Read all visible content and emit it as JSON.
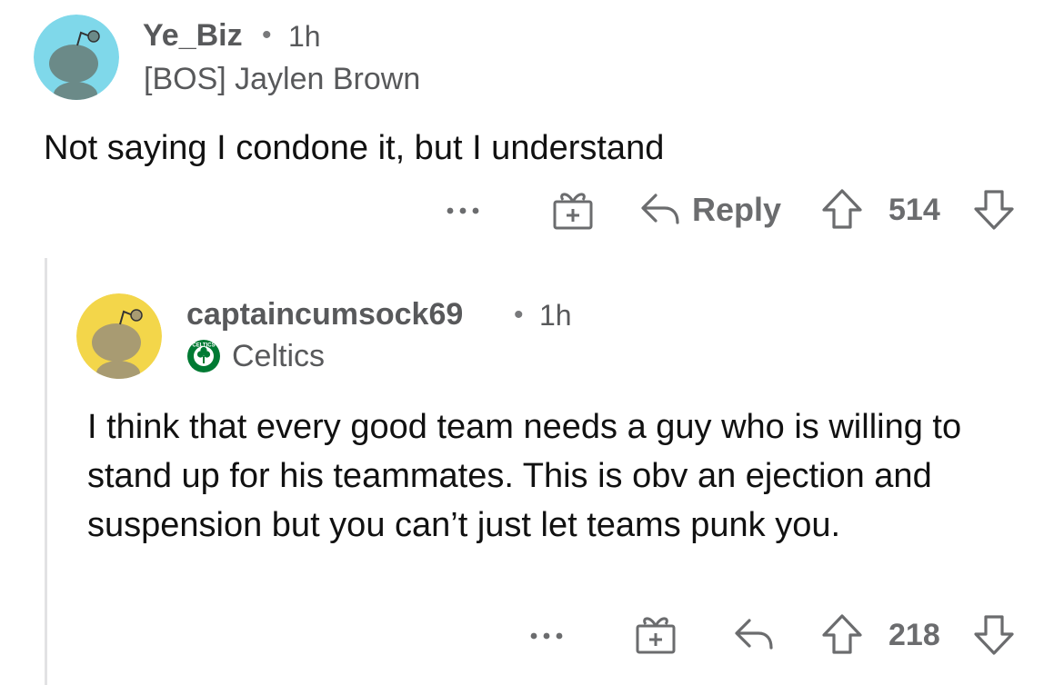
{
  "comments": [
    {
      "username": "Ye_Biz",
      "time": "1h",
      "flair": "[BOS] Jaylen Brown",
      "body": "Not saying I condone it, but I understand",
      "reply_label": "Reply",
      "score": "514",
      "avatar_color": "#7fd8ea"
    },
    {
      "username": "captaincumsock69",
      "time": "1h",
      "flair": "Celtics",
      "flair_badge_text": "CELTICS",
      "body": "I think that every good team needs a guy who is willing to stand up for his teammates. This is obv an ejection and suspension but you can’t just let teams punk you.",
      "score": "218",
      "avatar_color": "#f3d64a"
    }
  ],
  "colors": {
    "meta_text": "#58595b",
    "action_gray": "#6b6c6e",
    "thread_line": "#e2e2e4",
    "celtics_green": "#007a33"
  },
  "icons": [
    "more-icon",
    "award-gift-icon",
    "reply-arrow-icon",
    "upvote-icon",
    "downvote-icon",
    "snoo-avatar-icon",
    "celtics-flair-icon"
  ],
  "separator": "•"
}
